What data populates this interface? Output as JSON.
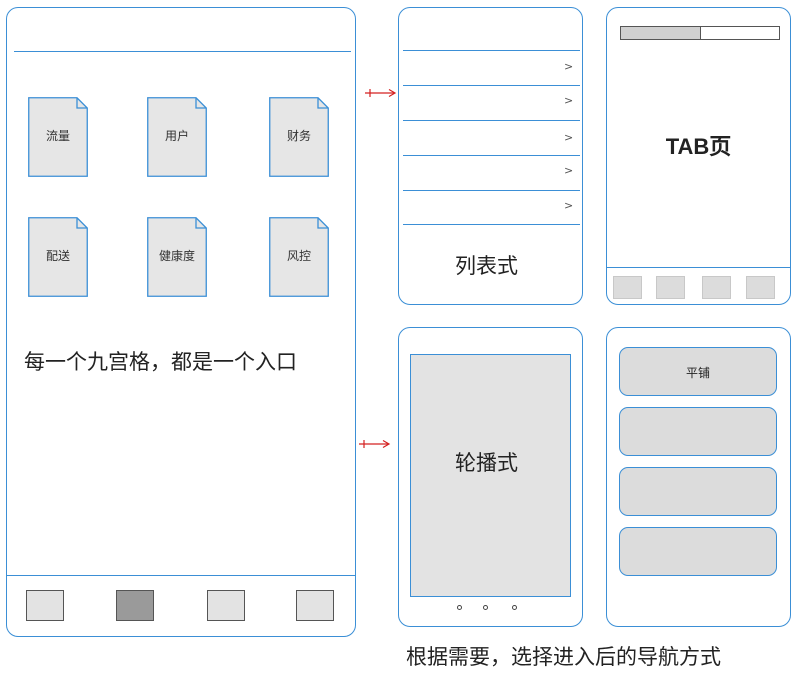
{
  "grid_screen": {
    "items": [
      "流量",
      "用户",
      "财务",
      "配送",
      "健康度",
      "风控"
    ],
    "caption": "每一个九宫格，都是一个入口"
  },
  "list_screen": {
    "chevrons": [
      ">",
      ">",
      ">",
      ">",
      ">"
    ],
    "caption": "列表式"
  },
  "tab_screen": {
    "caption": "TAB页"
  },
  "carousel_screen": {
    "caption": "轮播式"
  },
  "tile_screen": {
    "first_tile_label": "平铺"
  },
  "footer_caption": "根据需要，选择进入后的导航方式",
  "colors": {
    "frame": "#3b8fd6",
    "arrow": "#d42020",
    "fill_gray": "#e3e3e3"
  }
}
